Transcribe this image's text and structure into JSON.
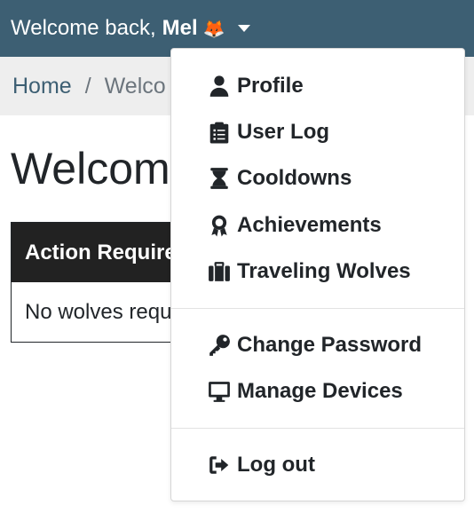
{
  "header": {
    "welcome_text": "Welcome back,",
    "user_name": "Mel",
    "user_emoji": "🦊"
  },
  "breadcrumb": {
    "home": "Home",
    "separator": "/",
    "current": "Welco"
  },
  "main": {
    "title": "Welcom",
    "card": {
      "header": "Action Require",
      "body": "No wolves requ"
    }
  },
  "user_menu": {
    "items": [
      {
        "label": "Profile",
        "icon": "user-icon"
      },
      {
        "label": "User Log",
        "icon": "clipboard-list-icon"
      },
      {
        "label": "Cooldowns",
        "icon": "hourglass-icon"
      },
      {
        "label": "Achievements",
        "icon": "award-icon"
      },
      {
        "label": "Traveling Wolves",
        "icon": "suitcase-icon"
      },
      {
        "label": "Change Password",
        "icon": "key-icon"
      },
      {
        "label": "Manage Devices",
        "icon": "desktop-icon"
      },
      {
        "label": "Log out",
        "icon": "sign-out-icon"
      }
    ]
  },
  "colors": {
    "navbar": "#3d5f73",
    "breadcrumb_bg": "#eeeeee",
    "card_header": "#222222",
    "link": "#3d5f73"
  }
}
